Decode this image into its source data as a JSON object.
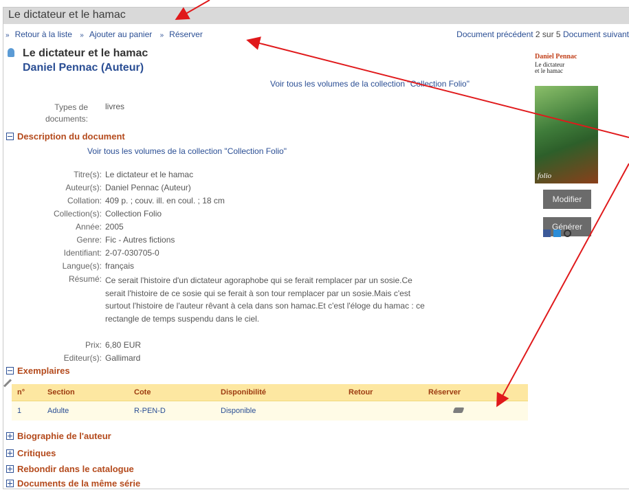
{
  "title_bar": "Le dictateur et le hamac",
  "nav": {
    "back_to_list": "Retour à la liste",
    "add_to_cart": "Ajouter au panier",
    "reserve": "Réserver",
    "previous": "Document précédent",
    "position": "2 sur 5",
    "next": "Document suivant"
  },
  "header": {
    "title": "Le dictateur et le hamac",
    "author": "Daniel Pennac (Auteur)",
    "collection_link": "Voir tous les volumes de la collection \"Collection Folio\""
  },
  "doc_type": {
    "label": "Types de documents:",
    "value": "livres"
  },
  "description": {
    "heading": "Description du document",
    "collection_link": "Voir tous les volumes de la collection \"Collection Folio\"",
    "fields": [
      {
        "key": "Titre(s):",
        "value": "Le dictateur et le hamac"
      },
      {
        "key": "Auteur(s):",
        "value": "Daniel Pennac (Auteur)"
      },
      {
        "key": "Collation:",
        "value": "409 p. ; couv. ill. en coul. ; 18 cm"
      },
      {
        "key": "Collection(s):",
        "value": "Collection Folio"
      },
      {
        "key": "Année:",
        "value": "2005"
      },
      {
        "key": "Genre:",
        "value": "Fic - Autres fictions"
      },
      {
        "key": "Identifiant:",
        "value": "2-07-030705-0"
      },
      {
        "key": "Langue(s):",
        "value": "français"
      },
      {
        "key": "Résumé:",
        "value": ""
      }
    ],
    "resume": "Ce serait l'histoire d'un dictateur agoraphobe qui se ferait remplacer par un sosie.Ce serait l'histoire de ce sosie qui se ferait à son tour remplacer par un sosie.Mais c'est surtout l'histoire de l'auteur rêvant à cela dans son hamac.Et c'est l'éloge du hamac : ce rectangle de temps suspendu dans le ciel.",
    "price_key": "Prix:",
    "price": "6,80 EUR",
    "publisher_key": "Editeur(s):",
    "publisher": "Gallimard"
  },
  "cover": {
    "line1": "Daniel Pennac",
    "line2": "Le dictateur",
    "line3": "et le hamac",
    "brand": "folio"
  },
  "buttons": {
    "modify": "Modifier",
    "generate": "Générer"
  },
  "exemplaires": {
    "heading": "Exemplaires",
    "columns": [
      "n°",
      "Section",
      "Cote",
      "Disponibilité",
      "Retour",
      "Réserver"
    ],
    "row": {
      "n": "1",
      "section": "Adulte",
      "cote": "R-PEN-D",
      "dispo": "Disponible",
      "retour": ""
    }
  },
  "sections": [
    "Biographie de l'auteur",
    "Critiques",
    "Rebondir dans le catalogue",
    "Documents de la même série"
  ],
  "colors": {
    "heading": "#b44a1c",
    "link": "#2a4e94",
    "table_header": "#fde7a1",
    "annotation_arrow": "#e0191b"
  }
}
